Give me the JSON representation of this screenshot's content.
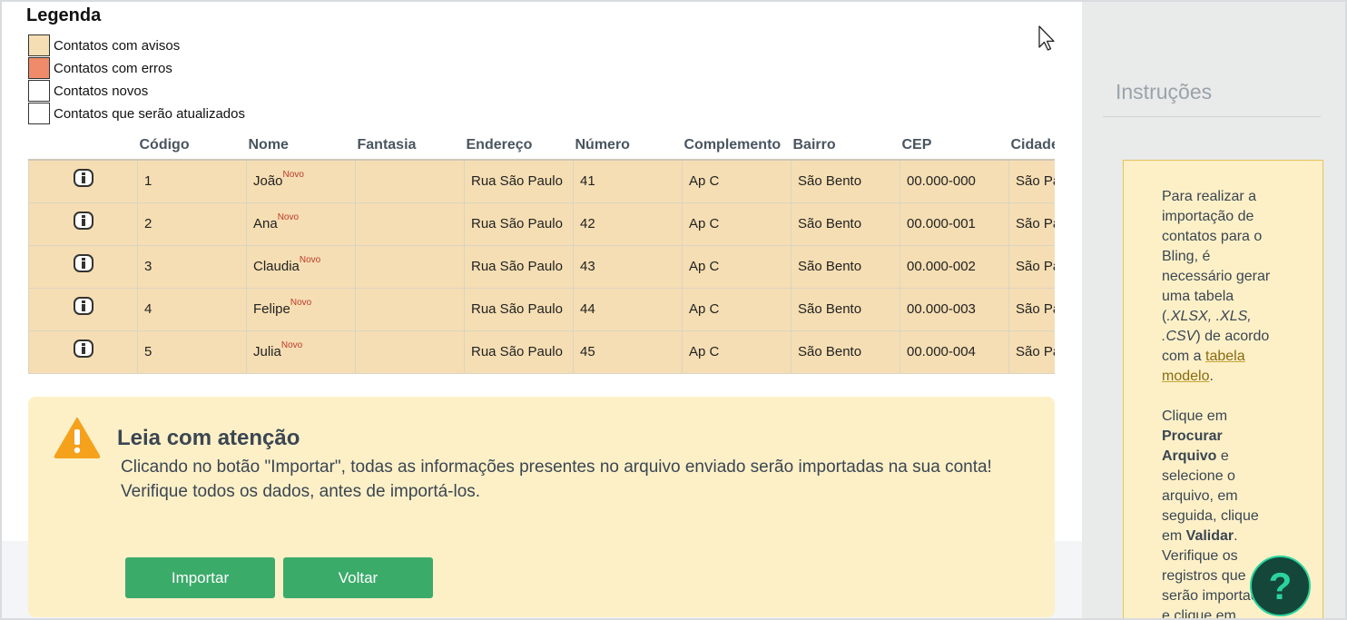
{
  "legend": {
    "title": "Legenda",
    "items": [
      {
        "label": "Contatos com avisos",
        "color": "#f5deb3"
      },
      {
        "label": "Contatos com erros",
        "color": "#ef8a6a"
      },
      {
        "label": "Contatos novos",
        "color": "#ffffff"
      },
      {
        "label": "Contatos que serão atualizados",
        "color": "#ffffff"
      }
    ]
  },
  "table": {
    "headers": [
      "",
      "Código",
      "Nome",
      "Fantasia",
      "Endereço",
      "Número",
      "Complemento",
      "Bairro",
      "CEP",
      "Cidade"
    ],
    "badge": "Novo",
    "rows": [
      {
        "codigo": "1",
        "nome": "João",
        "fantasia": "",
        "endereco": "Rua São Paulo",
        "numero": "41",
        "complemento": "Ap C",
        "bairro": "São Bento",
        "cep": "00.000-000",
        "cidade": "São Paulo"
      },
      {
        "codigo": "2",
        "nome": "Ana",
        "fantasia": "",
        "endereco": "Rua São Paulo",
        "numero": "42",
        "complemento": "Ap C",
        "bairro": "São Bento",
        "cep": "00.000-001",
        "cidade": "São Paulo"
      },
      {
        "codigo": "3",
        "nome": "Claudia",
        "fantasia": "",
        "endereco": "Rua São Paulo",
        "numero": "43",
        "complemento": "Ap C",
        "bairro": "São Bento",
        "cep": "00.000-002",
        "cidade": "São Paulo"
      },
      {
        "codigo": "4",
        "nome": "Felipe",
        "fantasia": "",
        "endereco": "Rua São Paulo",
        "numero": "44",
        "complemento": "Ap C",
        "bairro": "São Bento",
        "cep": "00.000-003",
        "cidade": "São Paulo"
      },
      {
        "codigo": "5",
        "nome": "Julia",
        "fantasia": "",
        "endereco": "Rua São Paulo",
        "numero": "45",
        "complemento": "Ap C",
        "bairro": "São Bento",
        "cep": "00.000-004",
        "cidade": "São Paulo"
      }
    ]
  },
  "warning": {
    "title": "Leia com atenção",
    "line1": "Clicando no botão \"Importar\", todas as informações presentes no arquivo enviado serão importadas na sua conta!",
    "line2": "Verifique todos os dados, antes de importá-los.",
    "import_label": "Importar",
    "back_label": "Voltar"
  },
  "sidebar": {
    "title": "Instruções",
    "p1_a": "Para realizar a importação de contatos para o Bling, é necessário gerar uma tabela (",
    "p1_b": ".XLSX, .XLS, .CSV",
    "p1_c": ") de acordo com a ",
    "p1_link": "tabela modelo",
    "p1_d": ".",
    "p2_a": "Clique em ",
    "p2_b": "Procurar Arquivo",
    "p2_c": " e selecione o arquivo, em seguida, clique em ",
    "p2_d": "Validar",
    "p2_e": ".",
    "p3": "Verifique os registros que serão importados e clique em",
    "help_label": "?"
  },
  "colors": {
    "row_warning": "#f5deb3",
    "button_green": "#3bab6a",
    "warning_bg": "#fdf0c7",
    "help_accent": "#2bd39c"
  }
}
